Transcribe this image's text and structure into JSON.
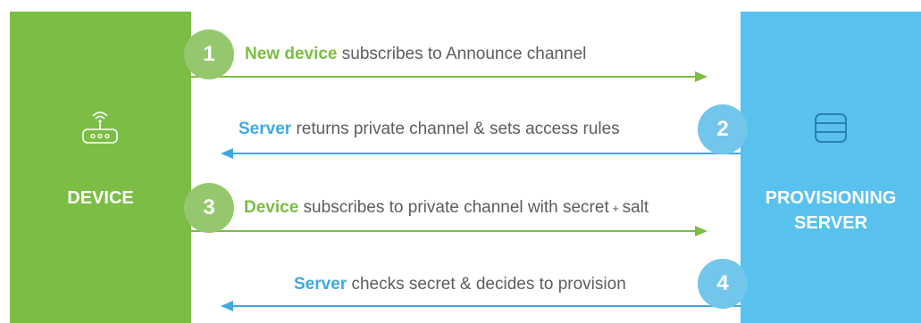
{
  "colors": {
    "device": "#7cbd45",
    "server": "#59c1ee",
    "green_text": "#7cbd45",
    "blue_text": "#3fa9e0",
    "body_text": "#5d5d5d"
  },
  "device": {
    "label": "DEVICE",
    "icon": "router-icon"
  },
  "server": {
    "label_line1": "PROVISIONING",
    "label_line2": "SERVER",
    "icon": "database-icon"
  },
  "steps": [
    {
      "number": "1",
      "direction": "device-to-server",
      "highlight": "New device",
      "text": " subscribes to Announce channel"
    },
    {
      "number": "2",
      "direction": "server-to-device",
      "highlight": "Server",
      "text": " returns private channel & sets access rules"
    },
    {
      "number": "3",
      "direction": "device-to-server",
      "highlight": "Device",
      "text": " subscribes to private channel with secret",
      "plus": " + ",
      "tail": "salt"
    },
    {
      "number": "4",
      "direction": "server-to-device",
      "highlight": "Server",
      "text": " checks secret & decides to provision"
    }
  ]
}
